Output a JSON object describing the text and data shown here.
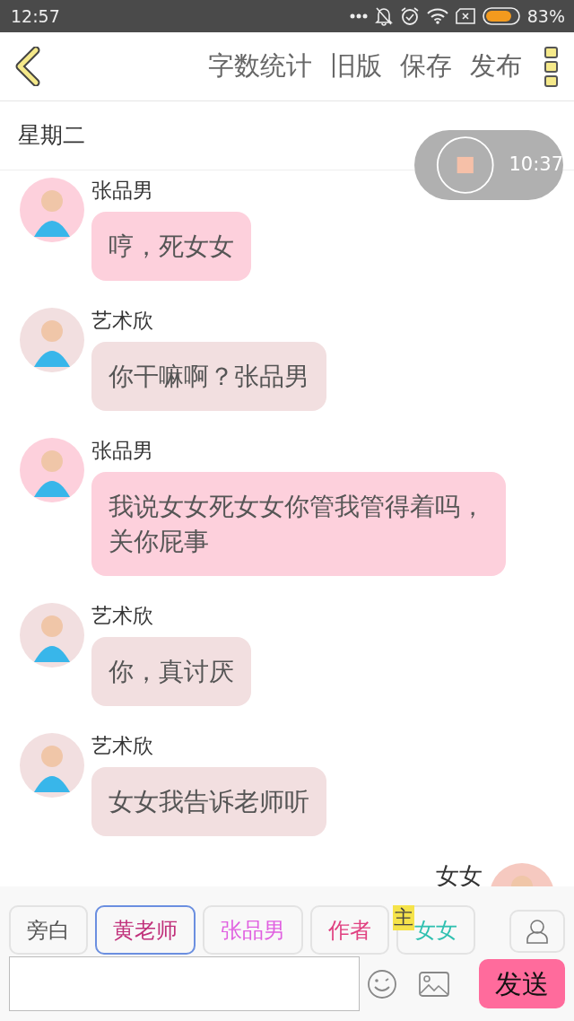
{
  "status_bar": {
    "time": "12:57",
    "battery": "83%"
  },
  "header": {
    "actions": [
      "字数统计",
      "旧版",
      "保存",
      "发布"
    ]
  },
  "day": "星期二",
  "recorder": {
    "time": "10:37"
  },
  "messages": [
    {
      "sender": "张品男",
      "text": "哼，死女女",
      "kind": "incoming",
      "color": "#fdd0dc"
    },
    {
      "sender": "艺术欣",
      "text": "你干嘛啊？张品男",
      "kind": "incoming",
      "color": "#f2dfe0"
    },
    {
      "sender": "张品男",
      "text": "我说女女死女女你管我管得着吗，关你屁事",
      "kind": "incoming",
      "color": "#fdd0dc"
    },
    {
      "sender": "艺术欣",
      "text": "你，真讨厌",
      "kind": "incoming",
      "color": "#f2dfe0"
    },
    {
      "sender": "艺术欣",
      "text": "女女我告诉老师听",
      "kind": "incoming",
      "color": "#f2dfe0"
    },
    {
      "sender": "女女",
      "kind": "outgoing",
      "color": "#f6c9c0"
    }
  ],
  "roles": [
    {
      "label": "旁白",
      "color": "#555555",
      "selected": false
    },
    {
      "label": "黄老师",
      "color": "#c0307a",
      "selected": true
    },
    {
      "label": "张品男",
      "color": "#e060e0",
      "selected": false
    },
    {
      "label": "作者",
      "color": "#e04080",
      "selected": false
    },
    {
      "label": "女女",
      "color": "#30c0b0",
      "selected": false,
      "badge": "主"
    }
  ],
  "send_button": "发送"
}
